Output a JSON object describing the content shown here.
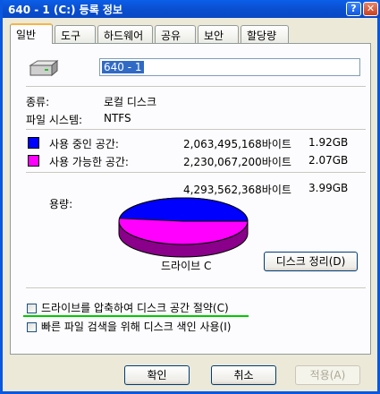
{
  "window": {
    "title": "640 - 1 (C:) 등록 정보",
    "help_label": "?",
    "close_label": "✕"
  },
  "tabs": [
    {
      "label": "일반",
      "active": true
    },
    {
      "label": "도구",
      "active": false
    },
    {
      "label": "하드웨어",
      "active": false
    },
    {
      "label": "공유",
      "active": false
    },
    {
      "label": "보안",
      "active": false
    },
    {
      "label": "할당량",
      "active": false
    }
  ],
  "general": {
    "volume_label": "640 - 1",
    "type_label": "종류:",
    "type_value": "로컬 디스크",
    "fs_label": "파일 시스템:",
    "fs_value": "NTFS",
    "used_label": "사용 중인 공간:",
    "used_bytes": "2,063,495,168바이트",
    "used_gb": "1.92GB",
    "free_label": "사용 가능한 공간:",
    "free_bytes": "2,230,067,200바이트",
    "free_gb": "2.07GB",
    "capacity_label": "용량:",
    "capacity_bytes": "4,293,562,368바이트",
    "capacity_gb": "3.99GB",
    "drive_label": "드라이브 C",
    "cleanup_button": "디스크 정리(D)",
    "compress_label": "드라이브를 압축하여 디스크 공간 절약(C)",
    "index_label": "빠른 파일 검색을 위해 디스크 색인 사용(I)"
  },
  "colors": {
    "used": "#0000ff",
    "free": "#ff00ff"
  },
  "chart_data": {
    "type": "pie",
    "categories": [
      "사용 중인 공간",
      "사용 가능한 공간"
    ],
    "values": [
      2063495168,
      2230067200
    ]
  },
  "buttons": {
    "ok": "확인",
    "cancel": "취소",
    "apply": "적용(A)"
  }
}
